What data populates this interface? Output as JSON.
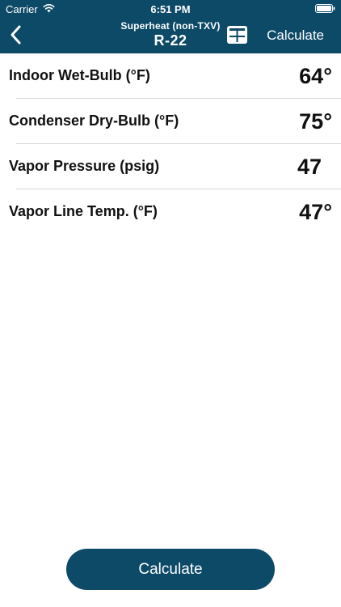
{
  "status_bar": {
    "carrier": "Carrier",
    "time": "6:51 PM",
    "wifi_icon": "wifi-icon",
    "battery_icon": "battery-icon"
  },
  "nav": {
    "subtitle": "Superheat (non-TXV)",
    "title": "R-22",
    "calculate_label": "Calculate",
    "back_icon": "chevron-left-icon",
    "table_icon": "table-grid-icon"
  },
  "rows": [
    {
      "label": "Indoor Wet-Bulb (°F)",
      "value": "64°"
    },
    {
      "label": "Condenser Dry-Bulb (°F)",
      "value": "75°"
    },
    {
      "label": "Vapor Pressure (psig)",
      "value": "47"
    },
    {
      "label": "Vapor Line Temp. (°F)",
      "value": "47°"
    }
  ],
  "calculate_button": {
    "label": "Calculate"
  },
  "colors": {
    "header_bg": "#0d4a68",
    "button_bg": "#0d4a68",
    "text": "#111111",
    "divider": "#d9d9d9"
  }
}
